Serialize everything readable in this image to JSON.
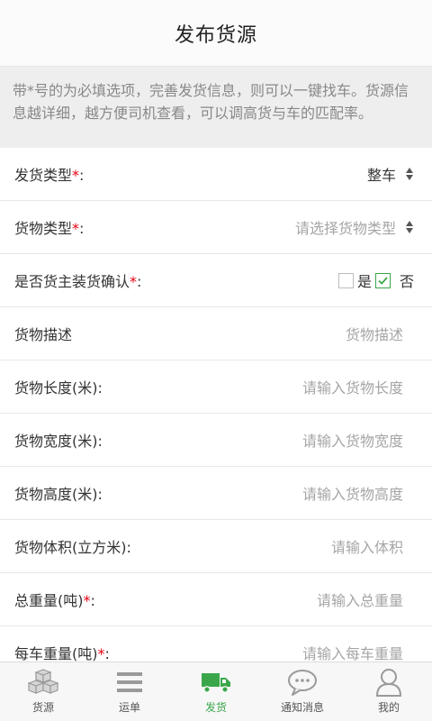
{
  "header": {
    "title": "发布货源"
  },
  "notice": {
    "text": "带*号的为必填选项，完善发货信息，则可以一键找车。货源信息越详细，越方便司机查看，可以调高货与车的匹配率。"
  },
  "form": {
    "shipping_type": {
      "label": "发货类型",
      "required_mark": "*",
      "colon": ":",
      "value": "整车"
    },
    "goods_type": {
      "label": "货物类型",
      "required_mark": "*",
      "colon": ":",
      "placeholder": "请选择货物类型"
    },
    "owner_confirm": {
      "label": "是否货主装货确认",
      "required_mark": "*",
      "colon": ":",
      "options": [
        {
          "label": "是",
          "checked": false
        },
        {
          "label": "否",
          "checked": true
        }
      ]
    },
    "description": {
      "label": "货物描述",
      "placeholder": "货物描述"
    },
    "length": {
      "label": "货物长度(米):",
      "placeholder": "请输入货物长度"
    },
    "width": {
      "label": "货物宽度(米):",
      "placeholder": "请输入货物宽度"
    },
    "height": {
      "label": "货物高度(米):",
      "placeholder": "请输入货物高度"
    },
    "volume": {
      "label": "货物体积(立方米):",
      "placeholder": "请输入体积"
    },
    "total_weight": {
      "label": "总重量(吨)",
      "required_mark": "*",
      "colon": ":",
      "placeholder": "请输入总重量"
    },
    "per_car_weight": {
      "label": "每车重量(吨)",
      "required_mark": "*",
      "colon": ":",
      "placeholder": "请输入每车重量"
    }
  },
  "tabbar": {
    "items": [
      {
        "label": "货源",
        "icon": "boxes-icon",
        "active": false
      },
      {
        "label": "运单",
        "icon": "list-icon",
        "active": false
      },
      {
        "label": "发货",
        "icon": "truck-icon",
        "active": true
      },
      {
        "label": "通知消息",
        "icon": "chat-icon",
        "active": false
      },
      {
        "label": "我的",
        "icon": "user-icon",
        "active": false
      }
    ]
  },
  "colors": {
    "accent": "#3aa649",
    "required": "#e60012",
    "placeholder": "#a5a5a5",
    "notice_bg": "#eeeeee",
    "icon_gray": "#9a9a9a"
  }
}
